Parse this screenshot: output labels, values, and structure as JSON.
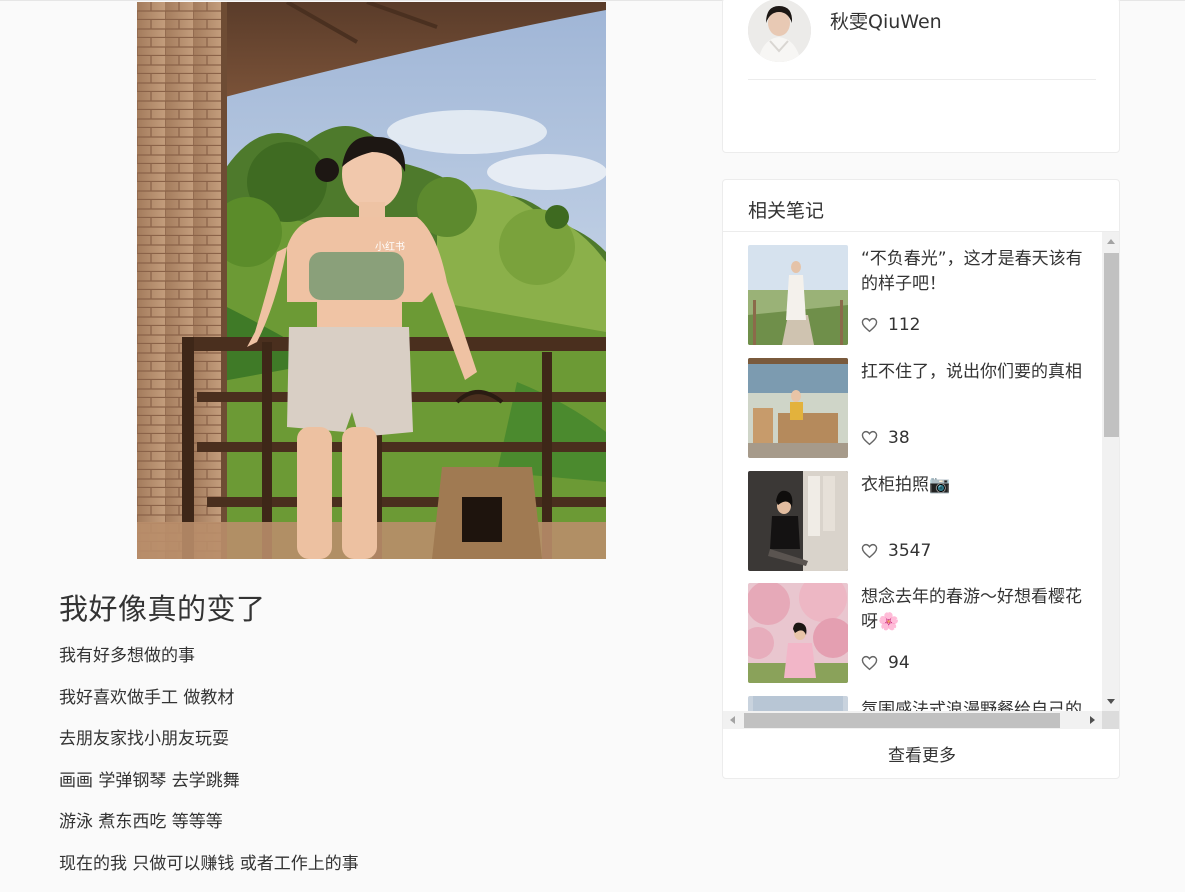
{
  "note": {
    "photo_watermark": "小红书",
    "title": "我好像真的变了",
    "body": [
      "我有好多想做的事",
      "我好喜欢做手工 做教材",
      "去朋友家找小朋友玩耍",
      "画画 学弹钢琴 去学跳舞",
      "游泳 煮东西吃 等等等",
      "现在的我 只做可以赚钱 或者工作上的事"
    ]
  },
  "author": {
    "name": "秋雯QiuWen"
  },
  "related": {
    "header": "相关笔记",
    "items": [
      {
        "title": "“不负春光”，这才是春天该有的样子吧！",
        "likes": "112",
        "icon": "heart-icon"
      },
      {
        "title": "扛不住了，说出你们要的真相",
        "likes": "38",
        "icon": "heart-icon"
      },
      {
        "title": "衣柜拍照📷",
        "likes": "3547",
        "icon": "heart-icon"
      },
      {
        "title": "想念去年的春游～好想看樱花呀🌸",
        "likes": "94",
        "icon": "heart-icon"
      },
      {
        "title": "氛围感法式浪漫野餐给自己的",
        "likes": "",
        "icon": "heart-icon"
      }
    ],
    "view_more": "查看更多"
  }
}
